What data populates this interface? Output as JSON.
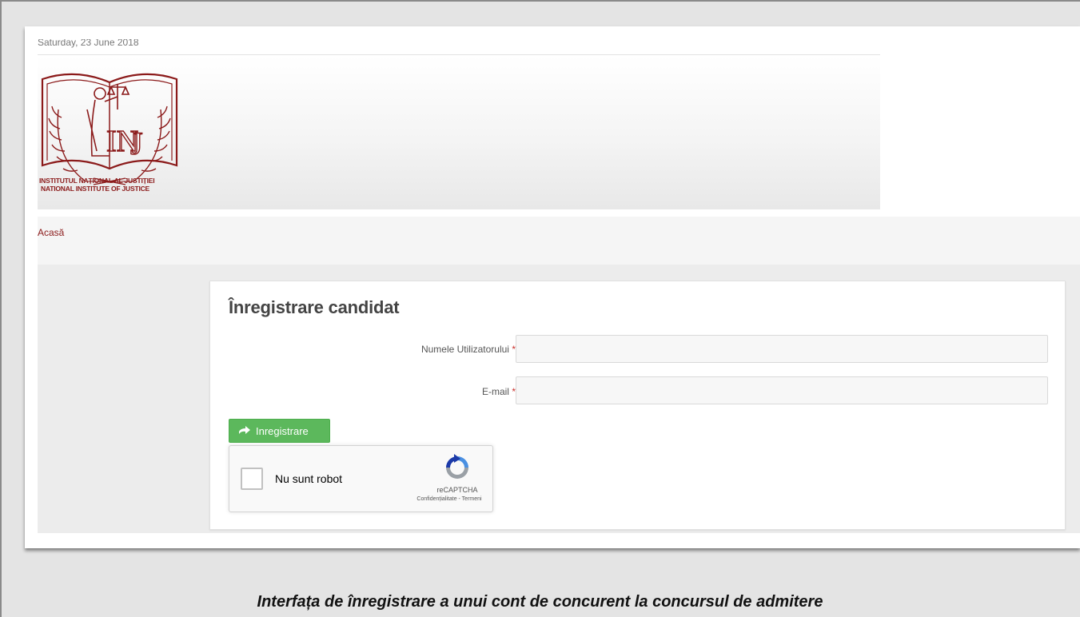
{
  "header": {
    "date": "Saturday, 23 June 2018",
    "logo_line1": "INSTITUTUL NAȚIONAL AL JUSTIȚIEI",
    "logo_line2": "NATIONAL INSTITUTE OF JUSTICE",
    "brand_color": "#8b1a1a"
  },
  "nav": {
    "home_label": "Acasă"
  },
  "form": {
    "title": "Înregistrare candidat",
    "username_label": "Numele Utilizatorului",
    "email_label": "E-mail",
    "required_mark": "*",
    "username_value": "",
    "email_value": "",
    "submit_label": "Inregistrare",
    "submit_icon": "arrow-right-icon",
    "submit_color": "#5cb85c"
  },
  "recaptcha": {
    "label": "Nu sunt robot",
    "brand": "reCAPTCHA",
    "terms": "Confidențialitate - Termeni"
  },
  "caption": "Interfața de înregistrare a unui cont de concurent la concursul de admitere"
}
